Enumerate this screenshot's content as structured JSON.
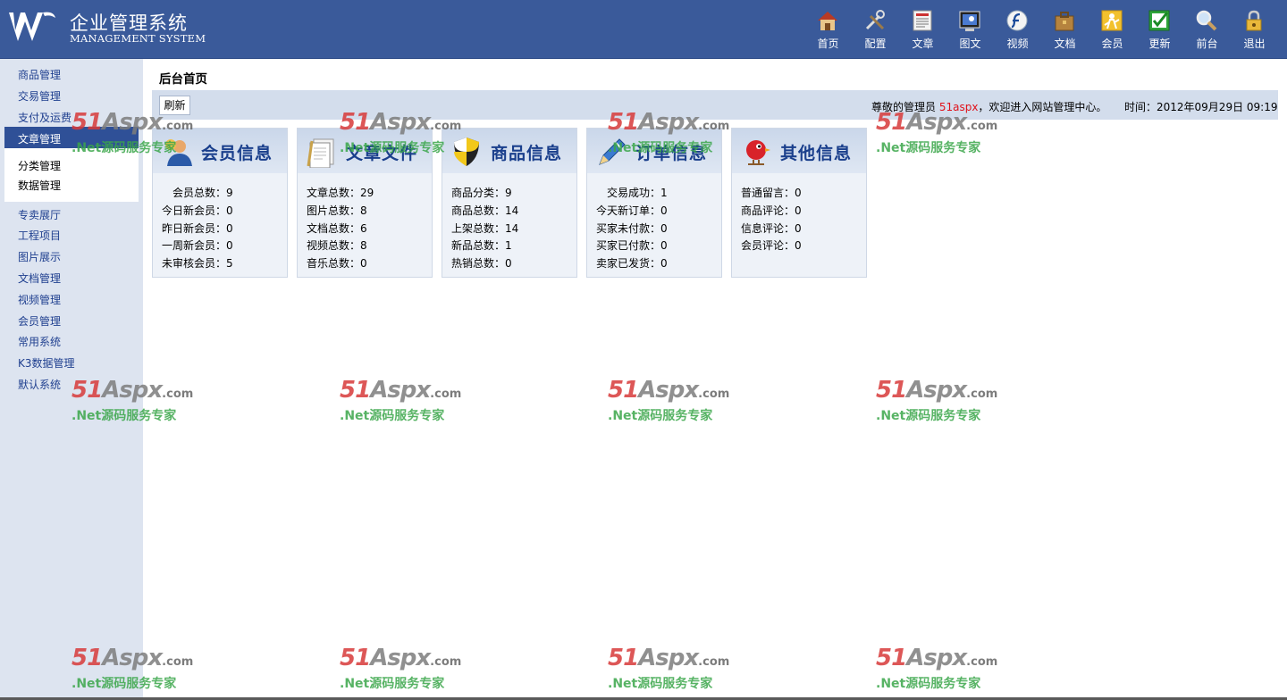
{
  "header": {
    "logo_cn": "企业管理系统",
    "logo_en": "MANAGEMENT SYSTEM",
    "nav": [
      {
        "label": "首页",
        "icon": "home-icon"
      },
      {
        "label": "配置",
        "icon": "tools-icon"
      },
      {
        "label": "文章",
        "icon": "newspaper-icon"
      },
      {
        "label": "图文",
        "icon": "image-icon"
      },
      {
        "label": "视频",
        "icon": "flash-icon"
      },
      {
        "label": "文档",
        "icon": "briefcase-icon"
      },
      {
        "label": "会员",
        "icon": "member-icon"
      },
      {
        "label": "更新",
        "icon": "checkbox-icon"
      },
      {
        "label": "前台",
        "icon": "magnifier-icon"
      },
      {
        "label": "退出",
        "icon": "lock-icon"
      }
    ]
  },
  "sidebar": {
    "items_top": [
      "商品管理",
      "交易管理",
      "支付及运费"
    ],
    "active": "文章管理",
    "sub_items": [
      "分类管理",
      "数据管理"
    ],
    "items_bottom": [
      "专卖展厅",
      "工程项目",
      "图片展示",
      "文档管理",
      "视频管理",
      "会员管理",
      "常用系统",
      "K3数据管理",
      "默认系统"
    ]
  },
  "main": {
    "page_title": "后台首页",
    "refresh_label": "刷新",
    "welcome_prefix": "尊敬的管理员 ",
    "admin_name": "51aspx",
    "welcome_suffix": "，欢迎进入网站管理中心。",
    "time_text": "时间：2012年09月29日 09:19"
  },
  "panels": [
    {
      "title": "会员信息",
      "icon": "member-info-icon",
      "rows": [
        "会员总数：9",
        "今日新会员：0",
        "昨日新会员：0",
        "一周新会员：0",
        "未审核会员：5"
      ]
    },
    {
      "title": "文章文件",
      "icon": "document-icon",
      "rows": [
        "文章总数：29",
        "图片总数：8",
        "文档总数：6",
        "视频总数：8",
        "音乐总数：0"
      ]
    },
    {
      "title": "商品信息",
      "icon": "shield-icon",
      "rows": [
        "商品分类：9",
        "商品总数：14",
        "上架总数：14",
        "新品总数：1",
        "热销总数：0"
      ]
    },
    {
      "title": "订单信息",
      "icon": "pencil-icon",
      "rows": [
        "交易成功：1",
        "今天新订单：0",
        "买家未付款：0",
        "买家已付款：0",
        "卖家已发货：0"
      ]
    },
    {
      "title": "其他信息",
      "icon": "bird-icon",
      "rows": [
        "普通留言：0",
        "商品评论：0",
        "信息评论：0",
        "会员评论：0"
      ]
    }
  ],
  "watermark": {
    "brand_51": "51",
    "brand_aspx": "Aspx",
    "brand_com": ".com",
    "slogan": ".Net源码服务专家"
  },
  "colors": {
    "header_bg": "#3a5a9a",
    "sidebar_bg": "#dde4f0",
    "sidebar_active": "#2f5097",
    "link": "#1f3f8f",
    "admin_name": "#e0121b",
    "panel_title": "#1a3f8c"
  }
}
